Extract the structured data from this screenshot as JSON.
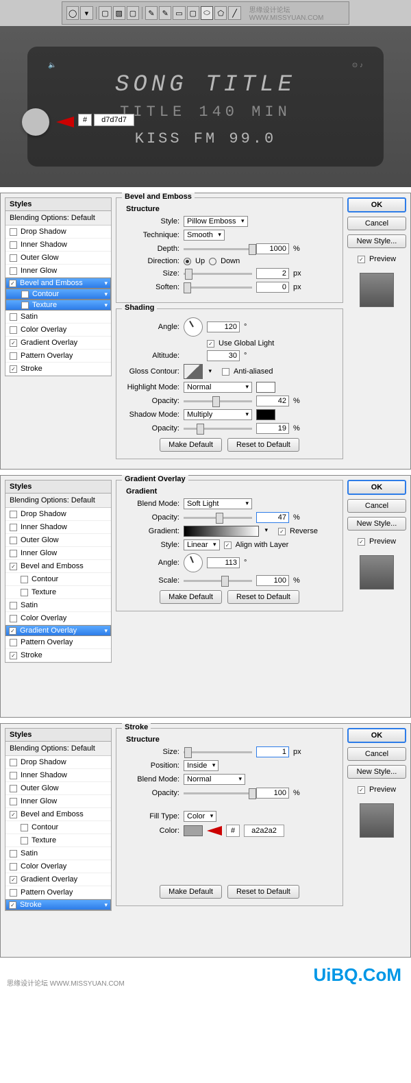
{
  "watermark_top": "思缘设计论坛  WWW.MISSYUAN.COM",
  "radio": {
    "line1": "SONG TITLE",
    "line2": "TITLE   140 MIN",
    "line3": "KISS FM 99.0",
    "hash": "#",
    "hex": "d7d7d7"
  },
  "styles_header": "Styles",
  "blending_options": "Blending Options: Default",
  "styles_items": [
    "Drop Shadow",
    "Inner Shadow",
    "Outer Glow",
    "Inner Glow",
    "Bevel and Emboss",
    "Contour",
    "Texture",
    "Satin",
    "Color Overlay",
    "Gradient Overlay",
    "Pattern Overlay",
    "Stroke"
  ],
  "bevel": {
    "legend": "Bevel and Emboss",
    "structure": "Structure",
    "style_lbl": "Style:",
    "style_val": "Pillow Emboss",
    "technique_lbl": "Technique:",
    "technique_val": "Smooth",
    "depth_lbl": "Depth:",
    "depth_val": "1000",
    "pct": "%",
    "direction_lbl": "Direction:",
    "up": "Up",
    "down": "Down",
    "size_lbl": "Size:",
    "size_val": "2",
    "px": "px",
    "soften_lbl": "Soften:",
    "soften_val": "0",
    "shading": "Shading",
    "angle_lbl": "Angle:",
    "angle_val": "120",
    "deg": "°",
    "global": "Use Global Light",
    "altitude_lbl": "Altitude:",
    "altitude_val": "30",
    "gloss_lbl": "Gloss Contour:",
    "aa": "Anti-aliased",
    "hlmode_lbl": "Highlight Mode:",
    "hlmode_val": "Normal",
    "hlopac_lbl": "Opacity:",
    "hlopac_val": "42",
    "shmode_lbl": "Shadow Mode:",
    "shmode_val": "Multiply",
    "shopac_lbl": "Opacity:",
    "shopac_val": "19"
  },
  "grad": {
    "legend": "Gradient Overlay",
    "gradient_hdr": "Gradient",
    "blend_lbl": "Blend Mode:",
    "blend_val": "Soft Light",
    "opac_lbl": "Opacity:",
    "opac_val": "47",
    "pct": "%",
    "grad_lbl": "Gradient:",
    "reverse": "Reverse",
    "style_lbl": "Style:",
    "style_val": "Linear",
    "align": "Align with Layer",
    "angle_lbl": "Angle:",
    "angle_val": "113",
    "deg": "°",
    "scale_lbl": "Scale:",
    "scale_val": "100"
  },
  "stroke": {
    "legend": "Stroke",
    "structure": "Structure",
    "size_lbl": "Size:",
    "size_val": "1",
    "px": "px",
    "pos_lbl": "Position:",
    "pos_val": "Inside",
    "blend_lbl": "Blend Mode:",
    "blend_val": "Normal",
    "opac_lbl": "Opacity:",
    "opac_val": "100",
    "pct": "%",
    "fill_lbl": "Fill Type:",
    "fill_val": "Color",
    "color_lbl": "Color:",
    "hash": "#",
    "hex": "a2a2a2"
  },
  "buttons": {
    "ok": "OK",
    "cancel": "Cancel",
    "newstyle": "New Style...",
    "preview": "Preview",
    "make_default": "Make Default",
    "reset_default": "Reset to Default"
  },
  "footer_logo": "UiBQ.CoM",
  "footer_credit": "思缘设计论坛  WWW.MISSYUAN.COM"
}
